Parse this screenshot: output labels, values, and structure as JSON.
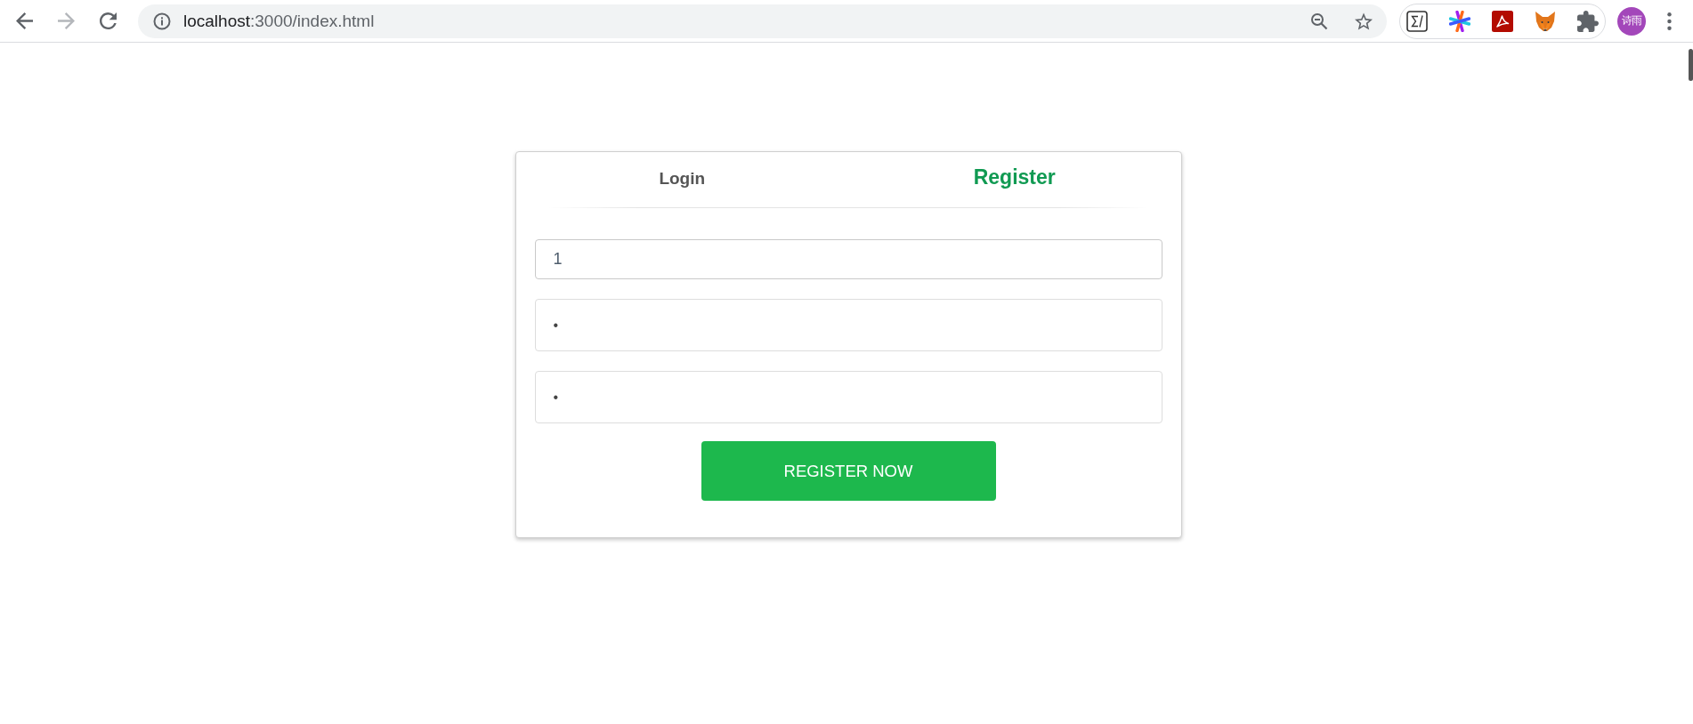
{
  "browser": {
    "nav_buttons": [
      {
        "kind": "back",
        "disabled": false
      },
      {
        "kind": "forward",
        "disabled": true
      },
      {
        "kind": "reload",
        "disabled": false
      }
    ],
    "address": {
      "host": "localhost",
      "path": ":3000/index.html"
    },
    "profile": {
      "initials": "诗雨"
    }
  },
  "tabs": [
    {
      "label": "Login",
      "selected": false
    },
    {
      "label": "Register",
      "selected": true
    }
  ],
  "fields": [
    {
      "kind": "text",
      "value": "1"
    },
    {
      "kind": "password",
      "value": "•"
    },
    {
      "kind": "password",
      "value": "•"
    }
  ],
  "submit_button": {
    "label": "REGISTER NOW"
  }
}
